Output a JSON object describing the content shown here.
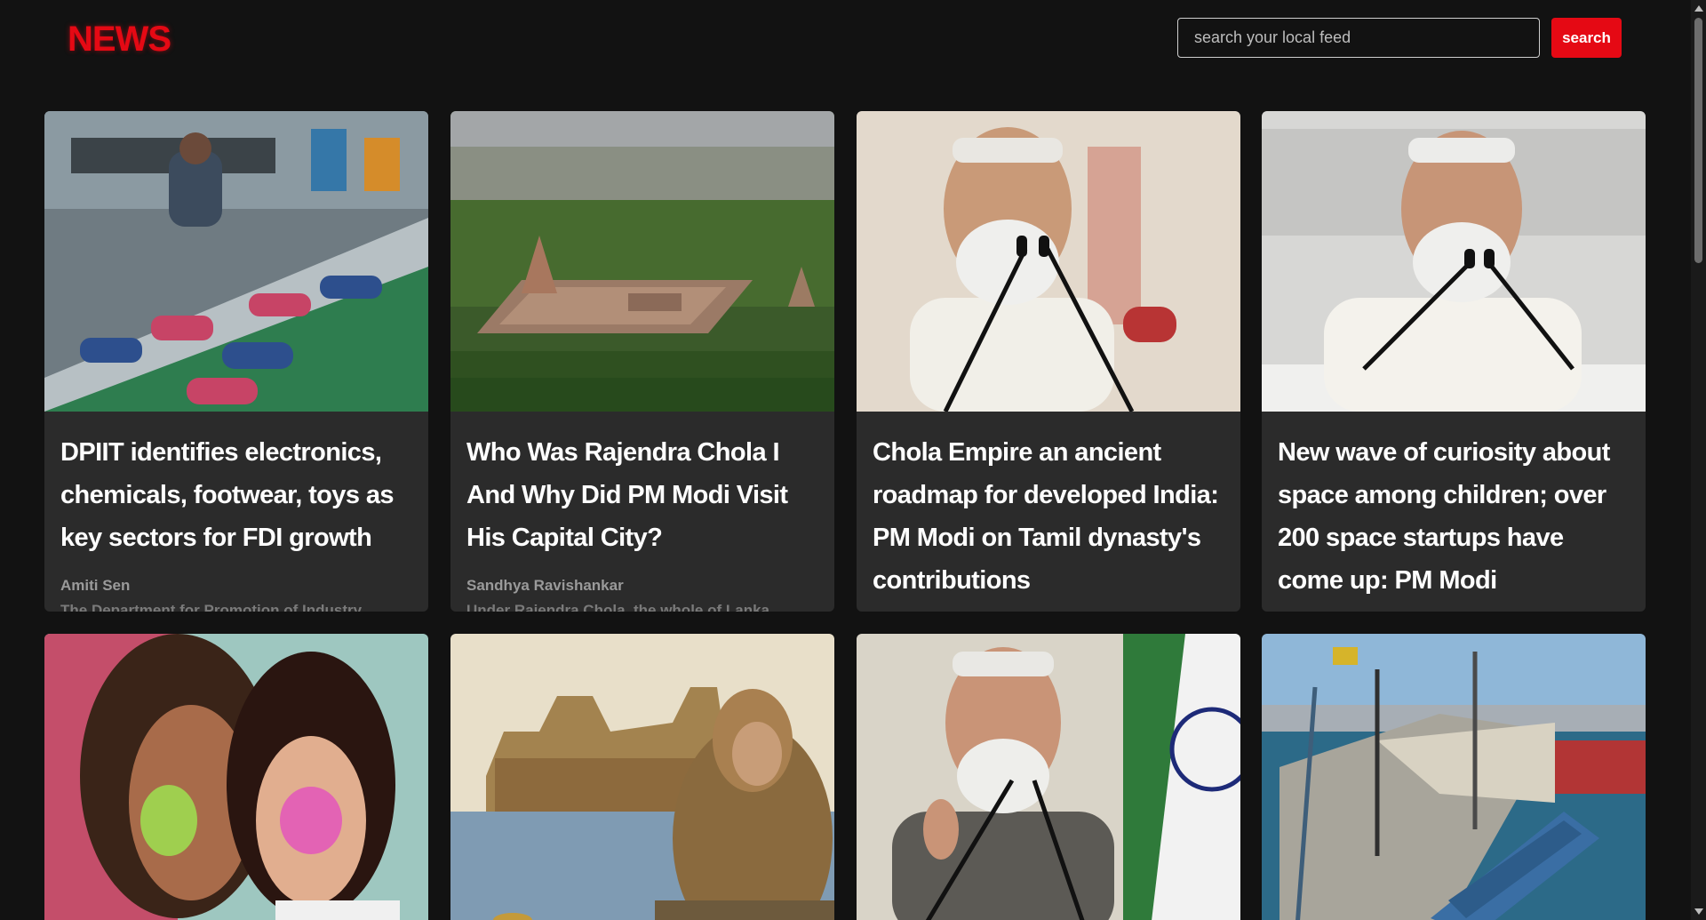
{
  "header": {
    "logo": "NEWS",
    "search_placeholder": "search your local feed",
    "search_label": "search"
  },
  "articles": [
    {
      "title": "DPIIT identifies electronics, chemicals, footwear, toys as key sectors for FDI growth",
      "author": "Amiti Sen",
      "snippet": "The Department for Promotion of Industry..."
    },
    {
      "title": "Who Was Rajendra Chola I And Why Did PM Modi Visit His Capital City?",
      "author": "Sandhya Ravishankar",
      "snippet": "Under Rajendra Chola, the whole of Lanka..."
    },
    {
      "title": "Chola Empire an ancient roadmap for developed India: PM Modi on Tamil dynasty's contributions",
      "author": "",
      "snippet": ""
    },
    {
      "title": "New wave of curiosity about space among children; over 200 space startups have come up: PM Modi",
      "author": "",
      "snippet": ""
    }
  ],
  "colors": {
    "brand": "#e50914",
    "background": "#121212",
    "card": "#2b2b2b"
  }
}
